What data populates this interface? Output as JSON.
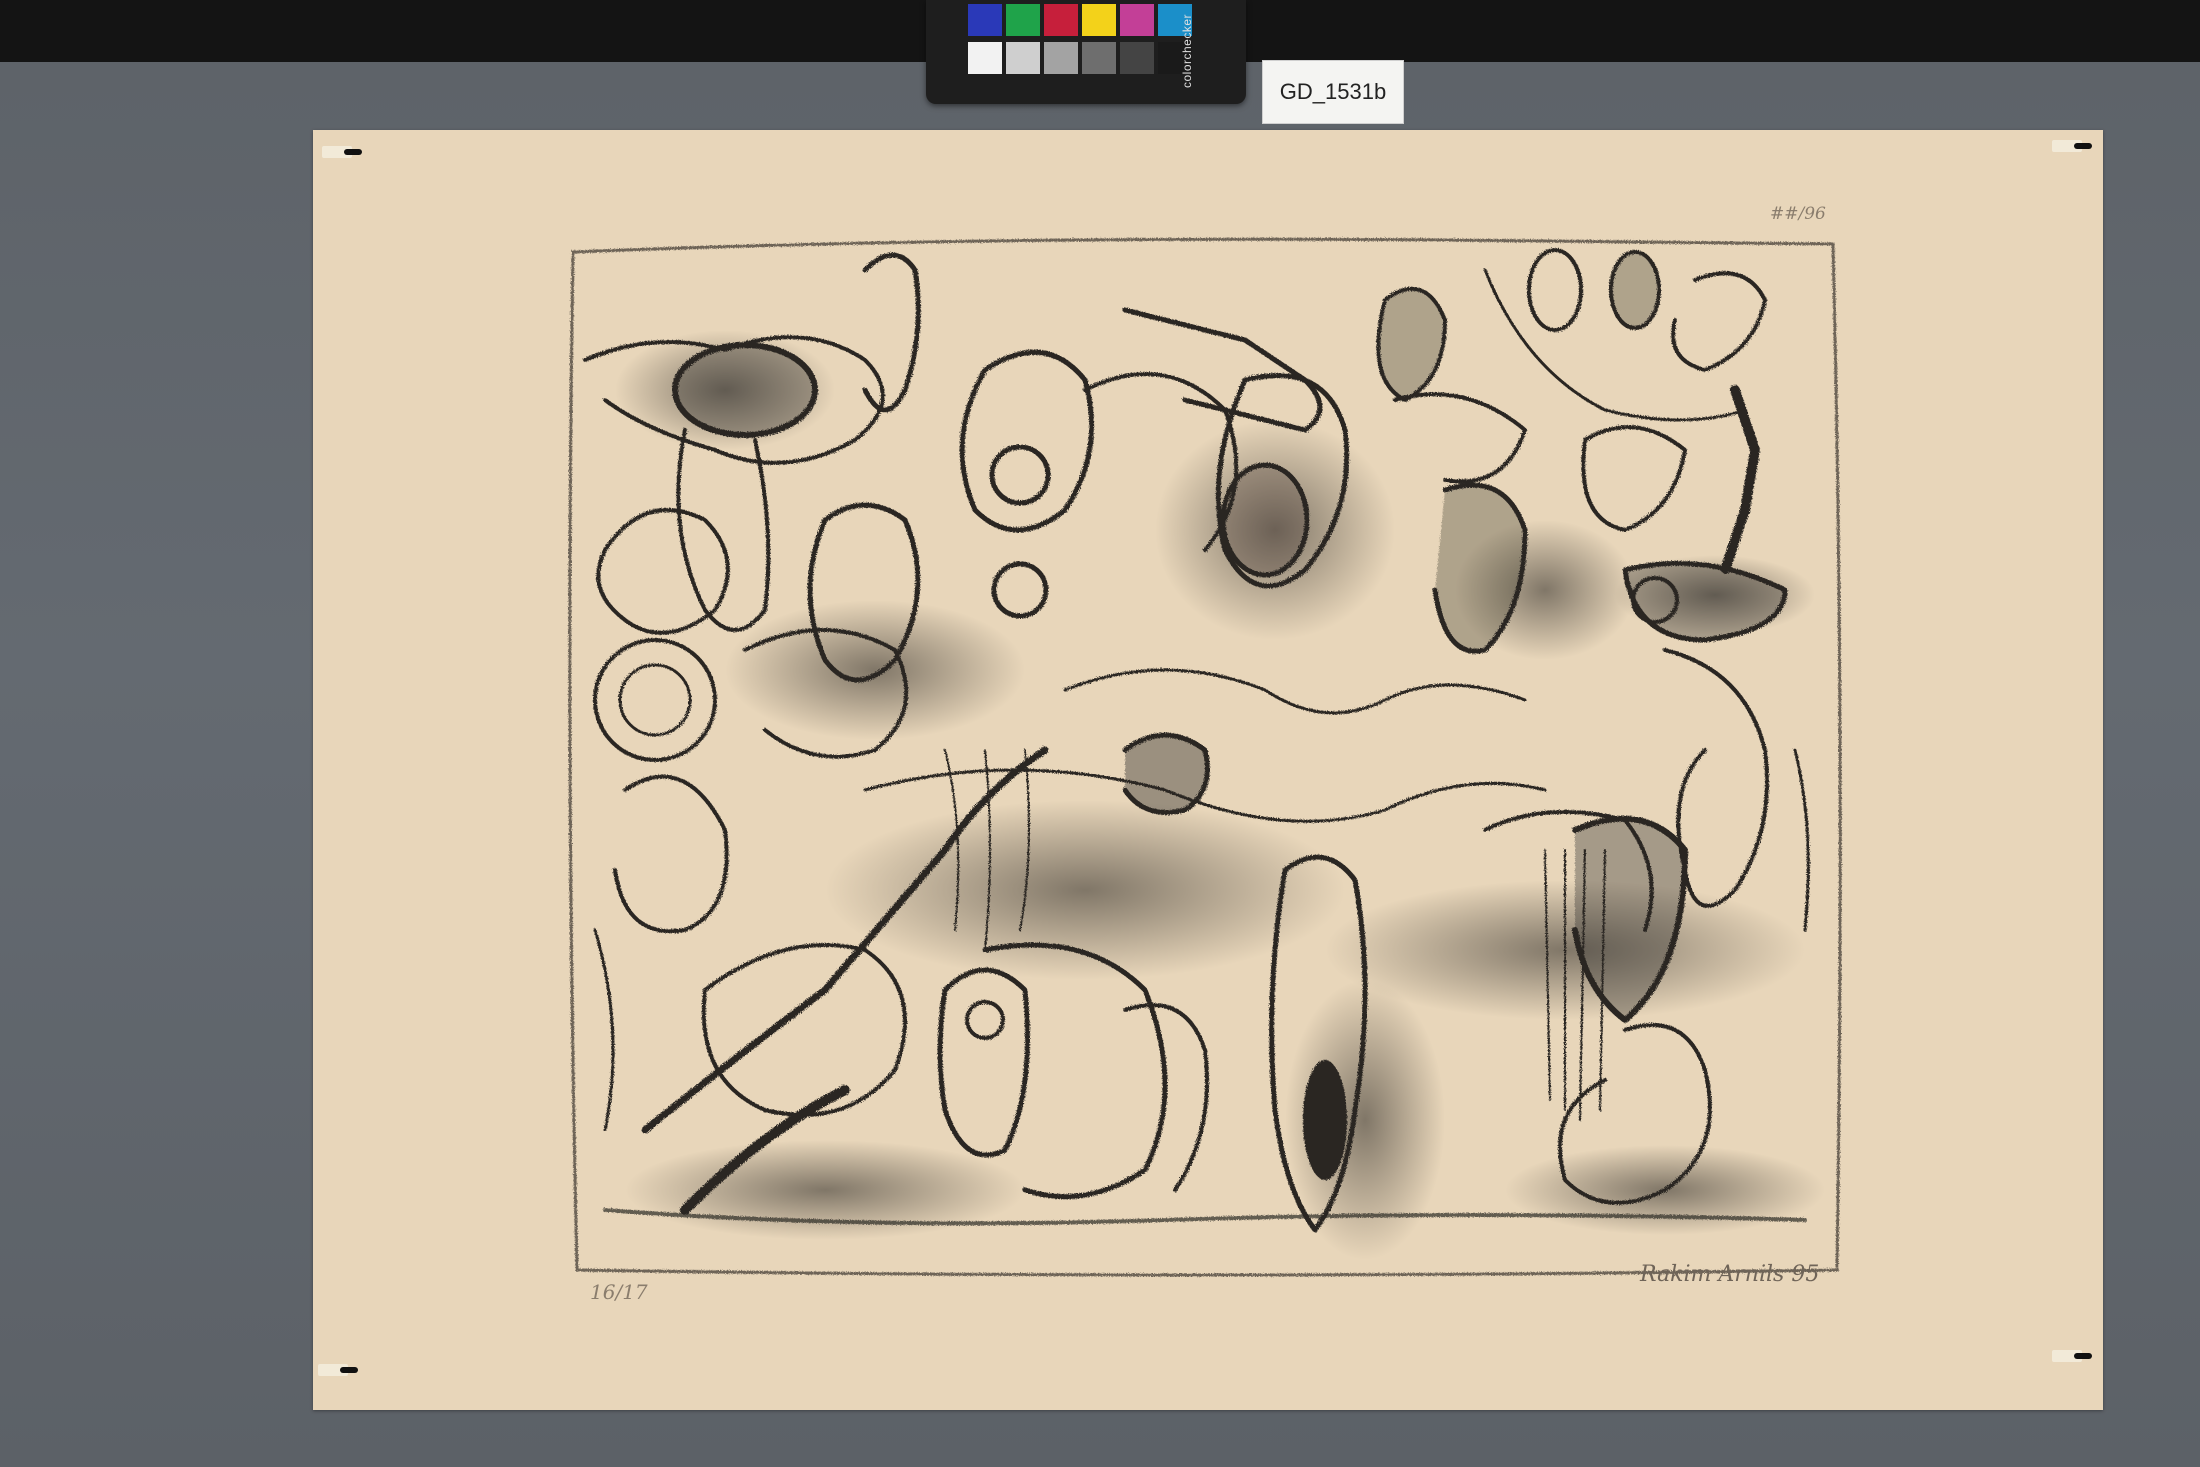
{
  "label_card": {
    "text": "GD_1531b"
  },
  "colorchecker": {
    "brand_text": "colorchecker",
    "top_row_colors": [
      "#2a39b8",
      "#1fa34a",
      "#c61f3b",
      "#f3d21a",
      "#c33f97",
      "#1b8fc9"
    ],
    "bottom_row_colors": [
      "#f2f2f2",
      "#cfcfcf",
      "#a3a3a3",
      "#6e6e6e",
      "#444444",
      "#1a1a1a"
    ]
  },
  "colors": {
    "background": "#5f646a",
    "paper": "#e8d6ba",
    "ink": "#2b2824"
  },
  "inscriptions": {
    "top_right": "##/96",
    "bottom_left": "16/17",
    "bottom_right": "Rakim Arnils 95"
  }
}
